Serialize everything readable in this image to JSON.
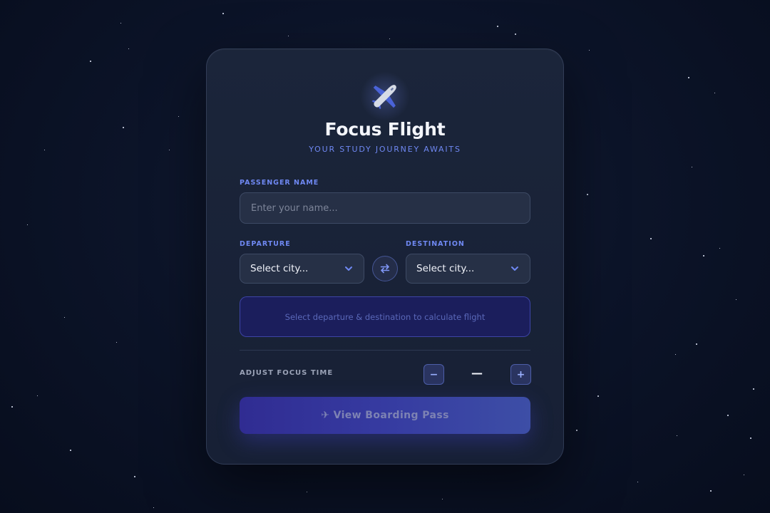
{
  "app": {
    "title": "Focus Flight",
    "subtitle": "YOUR STUDY JOURNEY AWAITS"
  },
  "form": {
    "passenger_label": "PASSENGER NAME",
    "passenger_placeholder": "Enter your name...",
    "passenger_value": "",
    "departure_label": "DEPARTURE",
    "departure_value": "Select city...",
    "destination_label": "DESTINATION",
    "destination_value": "Select city..."
  },
  "info": {
    "message": "Select departure & destination to calculate flight"
  },
  "focus": {
    "label": "ADJUST FOCUS TIME",
    "decrement_label": "−",
    "increment_label": "+",
    "time_value": "—"
  },
  "cta": {
    "label": "✈ View Boarding Pass"
  },
  "icons": {
    "logo": "airplane-icon",
    "swap": "swap-arrows-icon",
    "select_arrow": "chevron-down-icon"
  },
  "colors": {
    "accent": "#6f88f2",
    "card_background": "#1b253a",
    "page_background": "#0c1429",
    "info_box": "#1b1e5c",
    "cta_start": "#302c92",
    "cta_end": "#3d4ea6"
  }
}
